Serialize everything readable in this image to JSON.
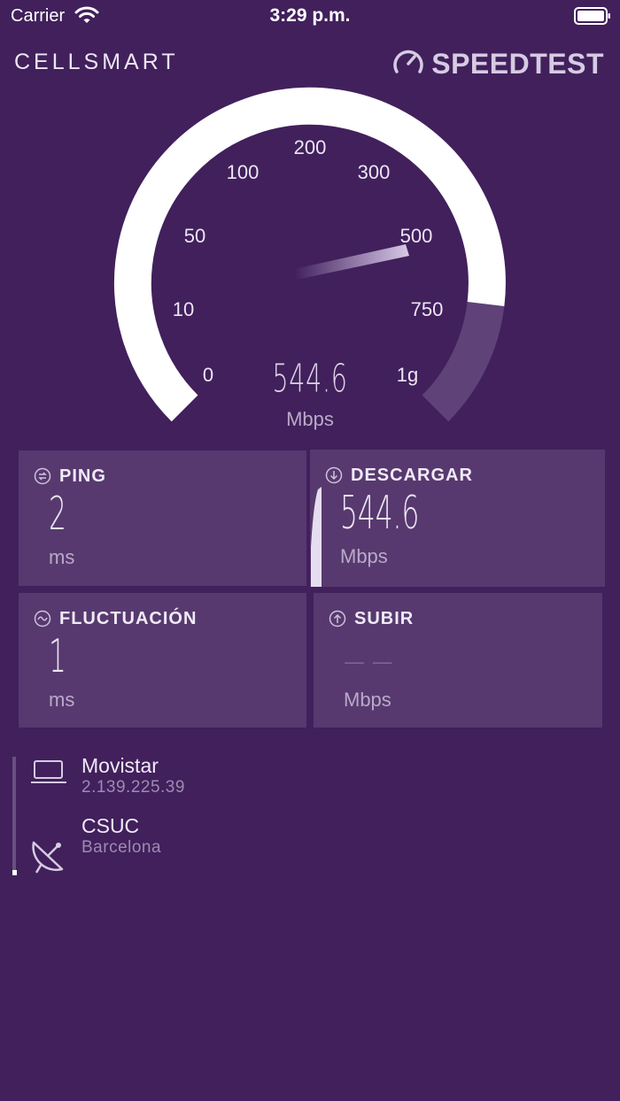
{
  "status_bar": {
    "carrier": "Carrier",
    "time": "3:29 p.m."
  },
  "brand": "CELLSMART",
  "speedtest_logo": "SPEEDTEST",
  "gauge": {
    "ticks": [
      "0",
      "10",
      "50",
      "100",
      "200",
      "300",
      "500",
      "750",
      "1g"
    ],
    "speed": "544.6",
    "unit": "Mbps"
  },
  "cards": {
    "ping": {
      "title": "PING",
      "value": "2",
      "unit": "ms"
    },
    "download": {
      "title": "DESCARGAR",
      "value": "544.6",
      "unit": "Mbps"
    },
    "jitter": {
      "title": "FLUCTUACIÓN",
      "value": "1",
      "unit": "ms"
    },
    "upload": {
      "title": "SUBIR",
      "value": "— —",
      "unit": "Mbps"
    }
  },
  "connection": {
    "isp_name": "Movistar",
    "isp_ip": "2.139.225.39",
    "server_name": "CSUC",
    "server_city": "Barcelona"
  },
  "colors": {
    "background": "#41205c",
    "card": "#57396f",
    "accent": "#ffffff"
  }
}
